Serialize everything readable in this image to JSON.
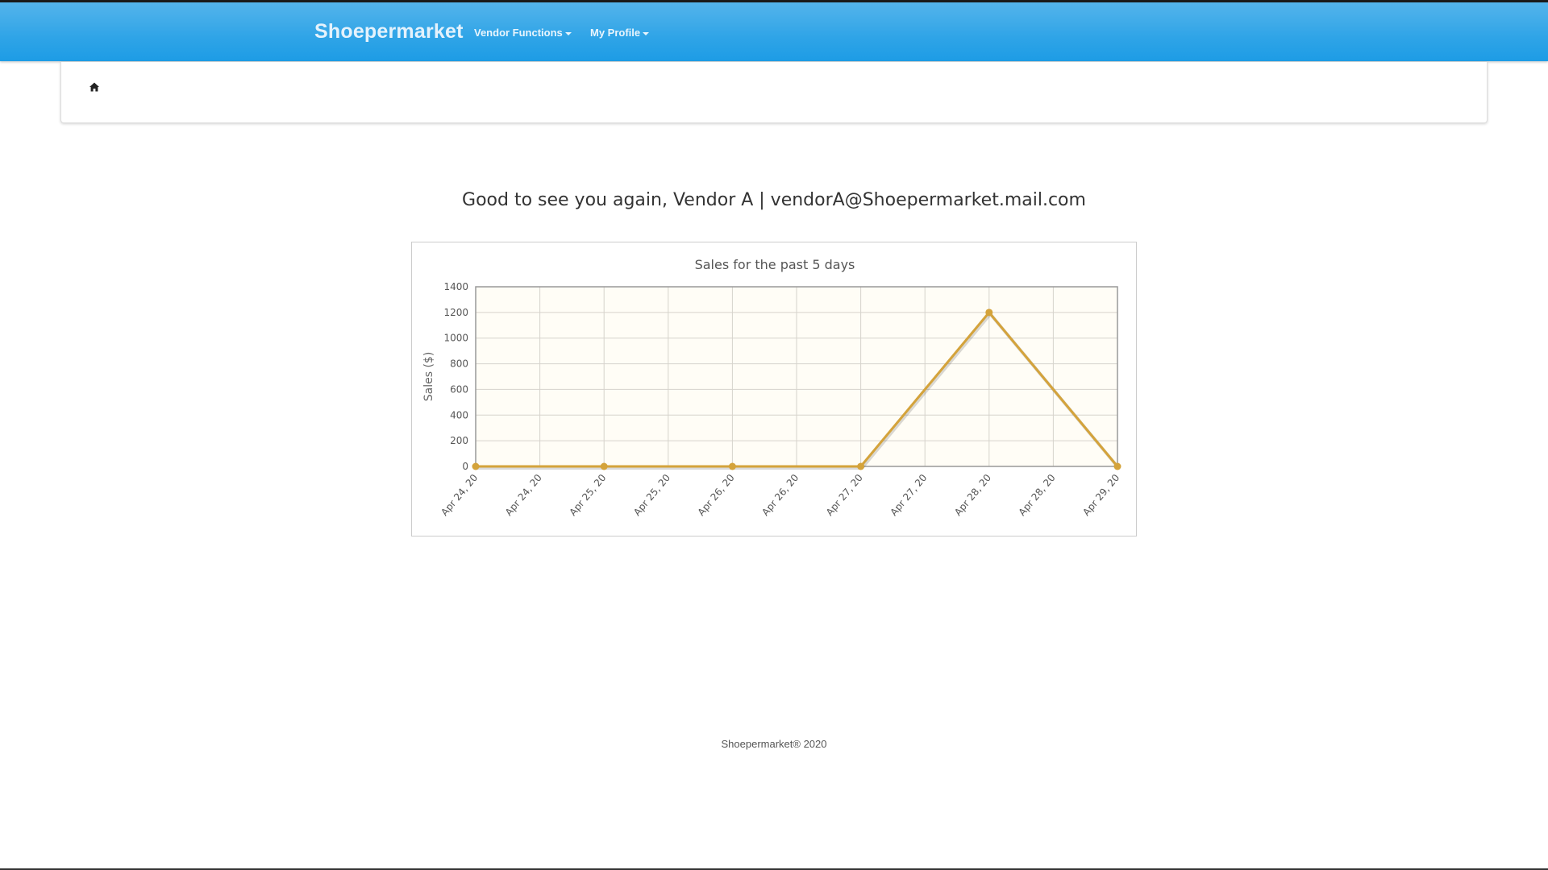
{
  "navbar": {
    "brand": "Shoepermarket",
    "items": [
      {
        "label": "Vendor Functions"
      },
      {
        "label": "My Profile"
      }
    ]
  },
  "breadcrumb": {
    "home_icon": "home-icon"
  },
  "welcome": {
    "text": "Good to see you again, Vendor A | vendorA@Shoepermarket.mail.com"
  },
  "chart_data": {
    "type": "line",
    "title": "Sales for the past 5 days",
    "xlabel": "",
    "ylabel": "Sales ($)",
    "x_tick_labels": [
      "Apr 24, 20",
      "Apr 24, 20",
      "Apr 25, 20",
      "Apr 25, 20",
      "Apr 26, 20",
      "Apr 26, 20",
      "Apr 27, 20",
      "Apr 27, 20",
      "Apr 28, 20",
      "Apr 28, 20",
      "Apr 29, 20"
    ],
    "x": [
      "Apr 24, 20",
      "Apr 25, 20",
      "Apr 26, 20",
      "Apr 27, 20",
      "Apr 28, 20",
      "Apr 29, 20"
    ],
    "values": [
      0,
      0,
      0,
      0,
      1200,
      0
    ],
    "ylim": [
      0,
      1400
    ],
    "y_ticks": [
      0,
      200,
      400,
      600,
      800,
      1000,
      1200,
      1400
    ],
    "grid": true,
    "line_color": "#d4a33b",
    "plot_background": "#fffdf6"
  },
  "footer": {
    "text": "Shoepermarket® 2020"
  }
}
